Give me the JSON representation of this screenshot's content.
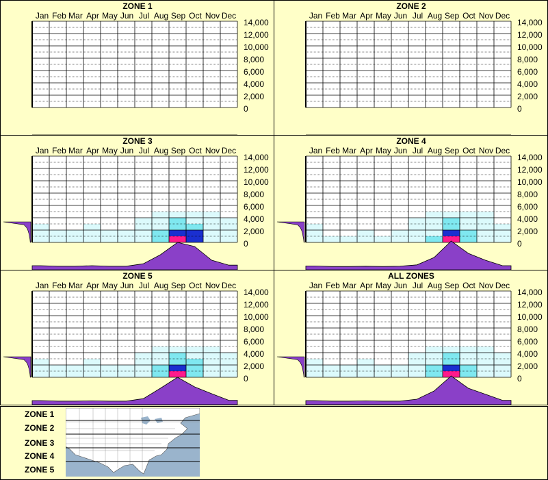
{
  "months": [
    "Jan",
    "Feb",
    "Mar",
    "Apr",
    "May",
    "Jun",
    "Jul",
    "Aug",
    "Sep",
    "Oct",
    "Nov",
    "Dec"
  ],
  "y_ticks": [
    "14,000",
    "12,000",
    "10,000",
    "8,000",
    "6,000",
    "4,000",
    "2,000",
    "0"
  ],
  "colors": {
    "background": "#ffffc8",
    "distribution": "#8a40c8",
    "heat_low": "#d8fafc",
    "heat_mid": "#7fe8f0",
    "heat_high": "#1a2fd0",
    "heat_peak": "#ff1a8c"
  },
  "chart_data": [
    {
      "type": "heatmap",
      "title": "ZONE 1",
      "ylim": [
        0,
        14000
      ],
      "activity": [
        0,
        0,
        0,
        0,
        0,
        0,
        0,
        0,
        0,
        0,
        0,
        0
      ],
      "elevation_profile": [
        0,
        0,
        0,
        0,
        0,
        0,
        0,
        0
      ]
    },
    {
      "type": "heatmap",
      "title": "ZONE 2",
      "ylim": [
        0,
        14000
      ],
      "activity": [
        0,
        0,
        0,
        0,
        0,
        0,
        0,
        0,
        0,
        0,
        0,
        0
      ],
      "elevation_profile": [
        0,
        0,
        0,
        0,
        0,
        0,
        0,
        0
      ]
    },
    {
      "type": "heatmap",
      "title": "ZONE 3",
      "ylim": [
        0,
        14000
      ],
      "activity": [
        0.05,
        0.03,
        0.03,
        0.05,
        0.03,
        0.03,
        0.12,
        0.45,
        0.9,
        0.75,
        0.25,
        0.07
      ],
      "elevation_profile": [
        0.02,
        0.03,
        0.05,
        0.07,
        0.1,
        0.15,
        0.25,
        1.0
      ],
      "peak_months": [
        "Aug",
        "Sep",
        "Oct"
      ]
    },
    {
      "type": "heatmap",
      "title": "ZONE 4",
      "ylim": [
        0,
        14000
      ],
      "activity": [
        0.04,
        0.02,
        0.02,
        0.03,
        0.02,
        0.03,
        0.08,
        0.35,
        0.95,
        0.5,
        0.25,
        0.05
      ],
      "elevation_profile": [
        0.02,
        0.03,
        0.05,
        0.07,
        0.1,
        0.15,
        0.25,
        1.0
      ],
      "peak_months": [
        "Sep"
      ]
    },
    {
      "type": "heatmap",
      "title": "ZONE 5",
      "ylim": [
        0,
        14000
      ],
      "activity": [
        0.05,
        0.03,
        0.03,
        0.04,
        0.03,
        0.03,
        0.12,
        0.5,
        0.9,
        0.55,
        0.3,
        0.06
      ],
      "elevation_profile": [
        0.02,
        0.03,
        0.05,
        0.07,
        0.1,
        0.15,
        0.25,
        1.0
      ],
      "peak_months": [
        "Sep"
      ]
    },
    {
      "type": "heatmap",
      "title": "ALL ZONES",
      "ylim": [
        0,
        14000
      ],
      "activity": [
        0.05,
        0.03,
        0.03,
        0.04,
        0.03,
        0.03,
        0.1,
        0.4,
        0.95,
        0.5,
        0.28,
        0.06
      ],
      "elevation_profile": [
        0.02,
        0.03,
        0.05,
        0.07,
        0.1,
        0.15,
        0.25,
        1.0
      ],
      "peak_months": [
        "Sep"
      ]
    }
  ],
  "legend": {
    "zones": [
      "ZONE 1",
      "ZONE 2",
      "ZONE 3",
      "ZONE 4",
      "ZONE 5"
    ],
    "map": "us-map-zones"
  }
}
